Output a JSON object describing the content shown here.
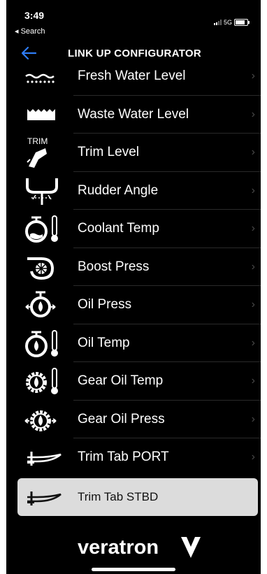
{
  "status_bar": {
    "time": "3:49",
    "back_label": "◂ Search",
    "network": "5G"
  },
  "nav": {
    "title": "LINK UP CONFIGURATOR"
  },
  "items": [
    {
      "label": "Fresh Water Level",
      "icon": "fresh-water-icon"
    },
    {
      "label": "Waste Water Level",
      "icon": "waste-water-icon"
    },
    {
      "label": "Trim Level",
      "icon": "trim-icon",
      "icon_text": "TRIM"
    },
    {
      "label": "Rudder Angle",
      "icon": "rudder-icon"
    },
    {
      "label": "Coolant Temp",
      "icon": "coolant-temp-icon"
    },
    {
      "label": "Boost Press",
      "icon": "turbo-icon"
    },
    {
      "label": "Oil Press",
      "icon": "oil-press-icon"
    },
    {
      "label": "Oil Temp",
      "icon": "oil-temp-icon"
    },
    {
      "label": "Gear Oil Temp",
      "icon": "gear-oil-temp-icon"
    },
    {
      "label": "Gear Oil Press",
      "icon": "gear-oil-press-icon"
    },
    {
      "label": "Trim Tab PORT",
      "icon": "trim-tab-icon"
    },
    {
      "label": "Trim Tab STBD",
      "icon": "trim-tab-icon",
      "selected": true
    }
  ],
  "chevron": "›",
  "brand": {
    "name": "veratron"
  },
  "colors": {
    "background": "#000000",
    "selected_row": "#dcdcdc",
    "back_arrow": "#2f7df6",
    "chevron": "#4a4a4a"
  }
}
